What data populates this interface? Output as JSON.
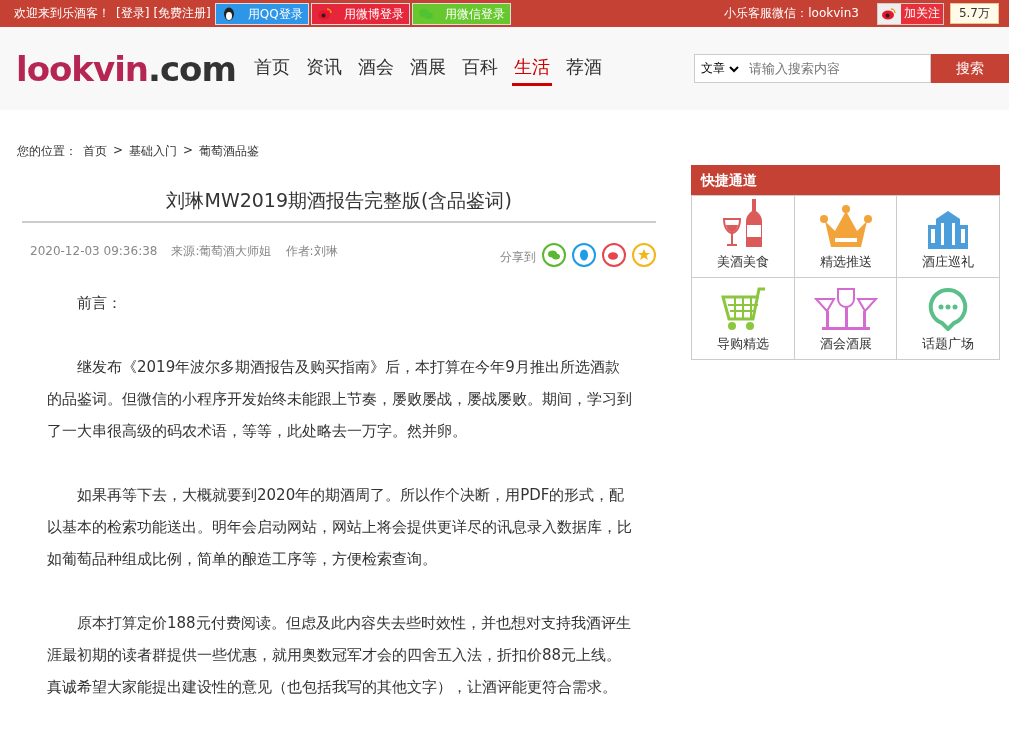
{
  "top_bar": {
    "welcome": "欢迎来到乐酒客！",
    "login": "[登录]",
    "register": "[免费注册]",
    "social_logins": [
      {
        "kind": "qq",
        "label": "用QQ登录"
      },
      {
        "kind": "weibo",
        "label": "用微博登录"
      },
      {
        "kind": "wechat",
        "label": "用微信登录"
      }
    ],
    "service": "小乐客服微信：lookvin3",
    "follow": "加关注",
    "followers": "5.7万"
  },
  "header": {
    "logo_main": "lookvin",
    "logo_suffix": ".com",
    "nav": [
      {
        "label": "首页",
        "selected": false
      },
      {
        "label": "资讯",
        "selected": false
      },
      {
        "label": "酒会",
        "selected": false
      },
      {
        "label": "酒展",
        "selected": false
      },
      {
        "label": "百科",
        "selected": false
      },
      {
        "label": "生活",
        "selected": true
      },
      {
        "label": "荐酒",
        "selected": false
      }
    ],
    "search": {
      "scope": "文章",
      "placeholder": "请输入搜索内容",
      "button": "搜索"
    }
  },
  "breadcrumb": {
    "prefix": "您的位置：",
    "items": [
      "首页",
      "基础入门",
      "葡萄酒品鉴"
    ],
    "separator": ">"
  },
  "article": {
    "title": "刘琳MW2019期酒报告完整版(含品鉴词)",
    "date": "2020-12-03 09:36:38",
    "source": "来源:葡萄酒大师姐",
    "author": "作者:刘琳",
    "share_label": "分享到",
    "share": [
      {
        "kind": "wechat",
        "color": "#5cb82e"
      },
      {
        "kind": "qq",
        "color": "#1e9ce8"
      },
      {
        "kind": "weibo",
        "color": "#e6474f"
      },
      {
        "kind": "favorite",
        "color": "#f3b618"
      }
    ],
    "paragraphs": [
      "前言：",
      "继发布《2019年波尔多期酒报告及购买指南》后，本打算在今年9月推出所选酒款的品鉴词。但微信的小程序开发始终未能跟上节奏，屡败屡战，屡战屡败。期间，学习到了一大串很高级的码农术语，等等，此处略去一万字。然并卵。",
      "如果再等下去，大概就要到2020年的期酒周了。所以作个决断，用PDF的形式，配以基本的检索功能送出。明年会启动网站，网站上将会提供更详尽的讯息录入数据库，比如葡萄品种组成比例，简单的酿造工序等，方便检索查询。",
      "原本打算定价188元付费阅读。但虑及此内容失去些时效性，并也想对支持我酒评生涯最初期的读者群提供一些优惠，就用奥数冠军才会的四舍五入法，折扣价88元上线。真诚希望大家能提出建设性的意见（也包括我写的其他文字），让酒评能更符合需求。"
    ]
  },
  "quick_links": {
    "title": "快捷通道",
    "items": [
      {
        "kind": "wine",
        "label": "美酒美食"
      },
      {
        "kind": "crown",
        "label": "精选推送"
      },
      {
        "kind": "building",
        "label": "酒庄巡礼"
      },
      {
        "kind": "cart",
        "label": "导购精选"
      },
      {
        "kind": "glasses",
        "label": "酒会酒展"
      },
      {
        "kind": "chat",
        "label": "话题广场"
      }
    ]
  }
}
